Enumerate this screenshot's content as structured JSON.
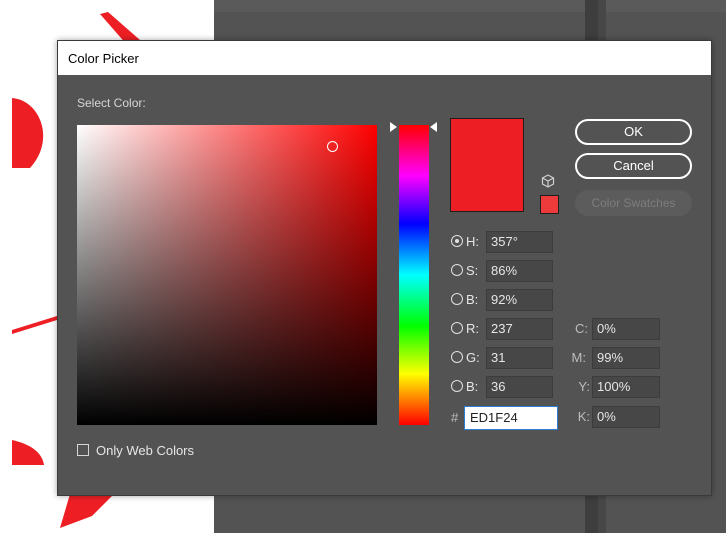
{
  "window": {
    "title": "Color Picker"
  },
  "picker": {
    "select_label": "Select Color:",
    "only_web_colors": "Only Web Colors"
  },
  "buttons": {
    "ok": "OK",
    "cancel": "Cancel",
    "swatches": "Color Swatches"
  },
  "hsb": [
    {
      "label": "H:",
      "value": "357°",
      "selected": true
    },
    {
      "label": "S:",
      "value": "86%",
      "selected": false
    },
    {
      "label": "B:",
      "value": "92%",
      "selected": false
    }
  ],
  "rgb": [
    {
      "label": "R:",
      "value": "237",
      "selected": false
    },
    {
      "label": "G:",
      "value": "31",
      "selected": false
    },
    {
      "label": "B:",
      "value": "36",
      "selected": false
    }
  ],
  "cmyk": [
    {
      "label": "C:",
      "value": "0%"
    },
    {
      "label": "M:",
      "value": "99%"
    },
    {
      "label": "Y:",
      "value": "100%"
    },
    {
      "label": "K:",
      "value": "0%"
    }
  ],
  "hex": {
    "symbol": "#",
    "value": "ED1F24"
  },
  "colors": {
    "current": "#ed1f24",
    "gamut_warning": "#ed3b3b"
  },
  "icons": {
    "web_safe": "cube-icon",
    "gamut": "gamut-warning-swatch"
  }
}
